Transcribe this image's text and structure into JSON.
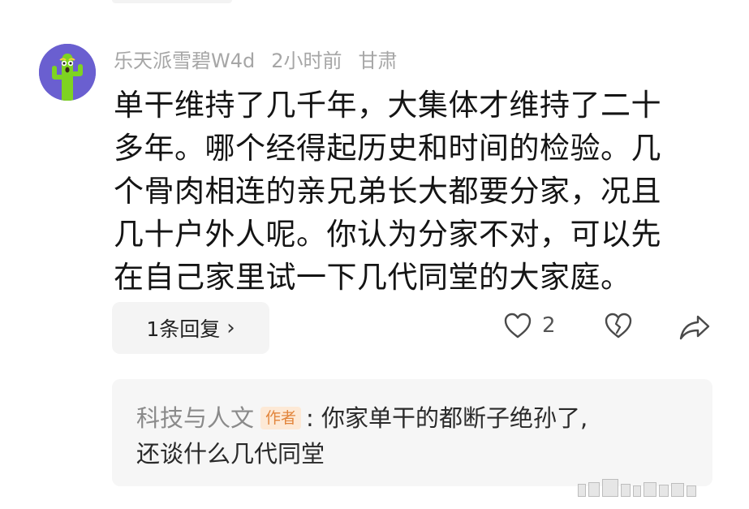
{
  "comment": {
    "username": "乐天派雪碧W4d",
    "time": "2小时前",
    "location": "甘肃",
    "lines": [
      "单干维持了几千年，大集体才维持了二十",
      "多年。哪个经得起历史和时间的检验。几",
      "个骨肉相连的亲兄弟长大都要分家，况且",
      "几十户外人呢。你认为分家不对，可以先",
      "在自己家里试一下几代同堂的大家庭。"
    ],
    "avatar_icon": "cactus-avatar"
  },
  "actions": {
    "reply_count_label": "1条回复",
    "like_count": "2",
    "like_icon": "heart-outline-icon",
    "dislike_icon": "broken-heart-icon",
    "share_icon": "share-arrow-icon"
  },
  "reply_preview": {
    "author": "科技与人文",
    "badge": "作者",
    "separator": ":",
    "text_line1": " 你家单干的都断子绝孙了,",
    "text_line2": "还谈什么几代同堂"
  },
  "colors": {
    "avatar_bg": "#6a5fd0",
    "badge_bg": "#fde9d6",
    "badge_text": "#e2853c",
    "meta_text": "#a6a6a6"
  }
}
